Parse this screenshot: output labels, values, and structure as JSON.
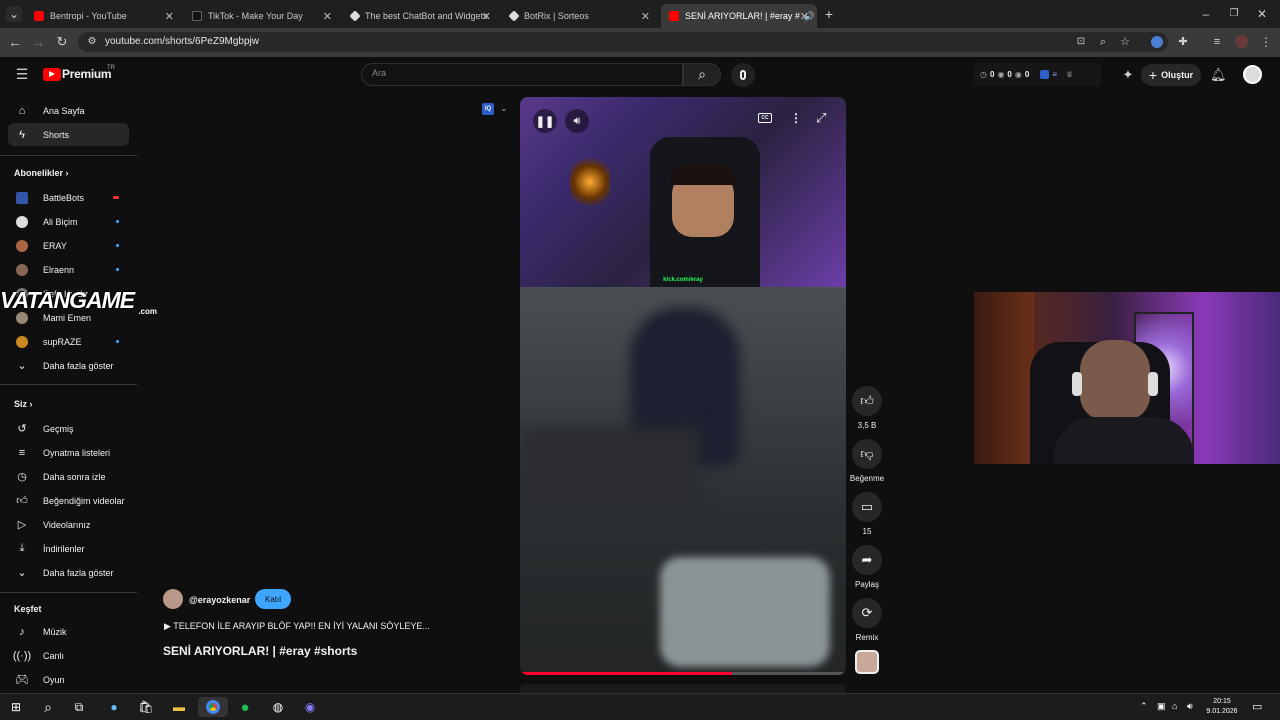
{
  "browser": {
    "tabs": [
      {
        "label": "Bentropi - YouTube",
        "color": "#ff0000"
      },
      {
        "label": "TikTok - Make Your Day",
        "color": "#111111"
      },
      {
        "label": "The best ChatBot and Widgets",
        "color": "#dddddd"
      },
      {
        "label": "BotRix | Sorteos",
        "color": "#dddddd"
      },
      {
        "label": "SENİ ARIYORLAR! | #eray #",
        "color": "#ff0000"
      }
    ],
    "url": "youtube.com/shorts/6PeZ9Mgbpjw"
  },
  "header": {
    "logo": "Premium",
    "region": "TR",
    "search_placeholder": "Ara",
    "create_label": "Oluştur",
    "counters": [
      "0",
      "0",
      "0"
    ]
  },
  "sidebar": {
    "main": [
      {
        "label": "Ana Sayfa",
        "icon": "home-icon"
      },
      {
        "label": "Shorts",
        "icon": "shorts-icon"
      }
    ],
    "subs_title": "Abonelikler",
    "subs": [
      {
        "label": "BattleBots",
        "color": "#3355aa"
      },
      {
        "label": "Ali Biçim",
        "color": "#dddddd"
      },
      {
        "label": "ERAY",
        "color": "#aa6644"
      },
      {
        "label": "Elraenn",
        "color": "#886655"
      },
      {
        "label": "Sefa Kındır",
        "color": "#777777"
      },
      {
        "label": "Mami Emen",
        "color": "#998877"
      },
      {
        "label": "supRAZE",
        "color": "#cc8822"
      }
    ],
    "more_subs": "Daha fazla göster",
    "you_title": "Siz",
    "you": [
      {
        "label": "Geçmiş",
        "icon": "history-icon"
      },
      {
        "label": "Oynatma listeleri",
        "icon": "playlist-icon"
      },
      {
        "label": "Daha sonra izle",
        "icon": "clock-icon"
      },
      {
        "label": "Beğendiğim videolar",
        "icon": "like-icon"
      },
      {
        "label": "Videolarınız",
        "icon": "video-icon"
      },
      {
        "label": "İndirilenler",
        "icon": "download-icon"
      }
    ],
    "more_you": "Daha fazla göster",
    "explore_title": "Keşfet",
    "explore": [
      {
        "label": "Müzik",
        "icon": "music-icon"
      },
      {
        "label": "Canlı",
        "icon": "live-icon"
      },
      {
        "label": "Oyun",
        "icon": "game-icon"
      }
    ]
  },
  "watermark": {
    "text": "VATANGAME",
    "sub": ".com"
  },
  "video": {
    "handle": "@erayozkenar",
    "join": "Katıl",
    "description": "▶ TELEFON İLE ARAYIP BLÖF YAP!! EN İYİ YALANI SÖYLEYE...",
    "title": "SENİ ARIYORLAR! | #eray #shorts",
    "overlay_text": "kick.com/eray",
    "progress": 0.65
  },
  "actions": [
    {
      "label": "3,5 B",
      "icon": "like-icon"
    },
    {
      "label": "Beğenme",
      "icon": "dislike-icon"
    },
    {
      "label": "15",
      "icon": "comment-icon"
    },
    {
      "label": "Paylaş",
      "icon": "share-icon"
    },
    {
      "label": "Remix",
      "icon": "remix-icon"
    }
  ],
  "taskbar": {
    "time": "20:15",
    "date": "9.01.2026"
  }
}
